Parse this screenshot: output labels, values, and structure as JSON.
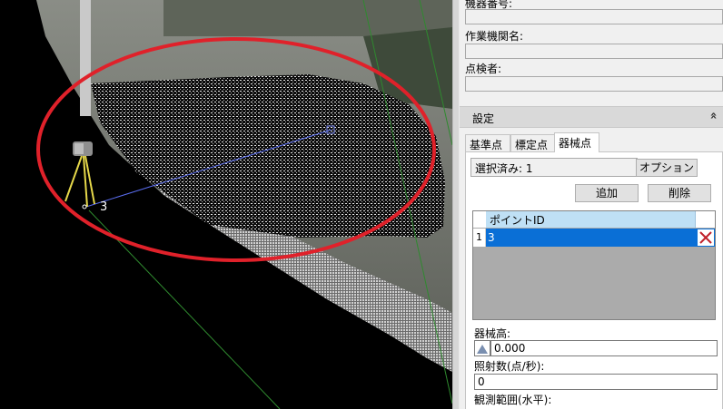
{
  "inspection": {
    "device_number_label": "機器番号:",
    "agency_label": "作業機関名:",
    "inspector_label": "点検者:"
  },
  "settings": {
    "title": "設定",
    "collapse_glyph": "»",
    "tabs": [
      {
        "label": "基準点",
        "active": false
      },
      {
        "label": "標定点",
        "active": false
      },
      {
        "label": "器械点",
        "active": true
      }
    ],
    "selected_text": "選択済み: 1",
    "option_button": "オプション",
    "add_button": "追加",
    "delete_button": "削除",
    "grid": {
      "column_header": "ポイントID",
      "rows": [
        {
          "num": "1",
          "point_id": "3"
        }
      ]
    },
    "instrument_height_label": "器械高:",
    "instrument_height_value": "0.000",
    "fire_rate_label": "照射数(点/秒):",
    "fire_rate_value": "0",
    "observation_range_label": "観測範囲(水平):"
  },
  "viewport": {
    "point_label": "3",
    "highlight_color": "#e0212a",
    "selection_color": "#0a6fd6"
  }
}
